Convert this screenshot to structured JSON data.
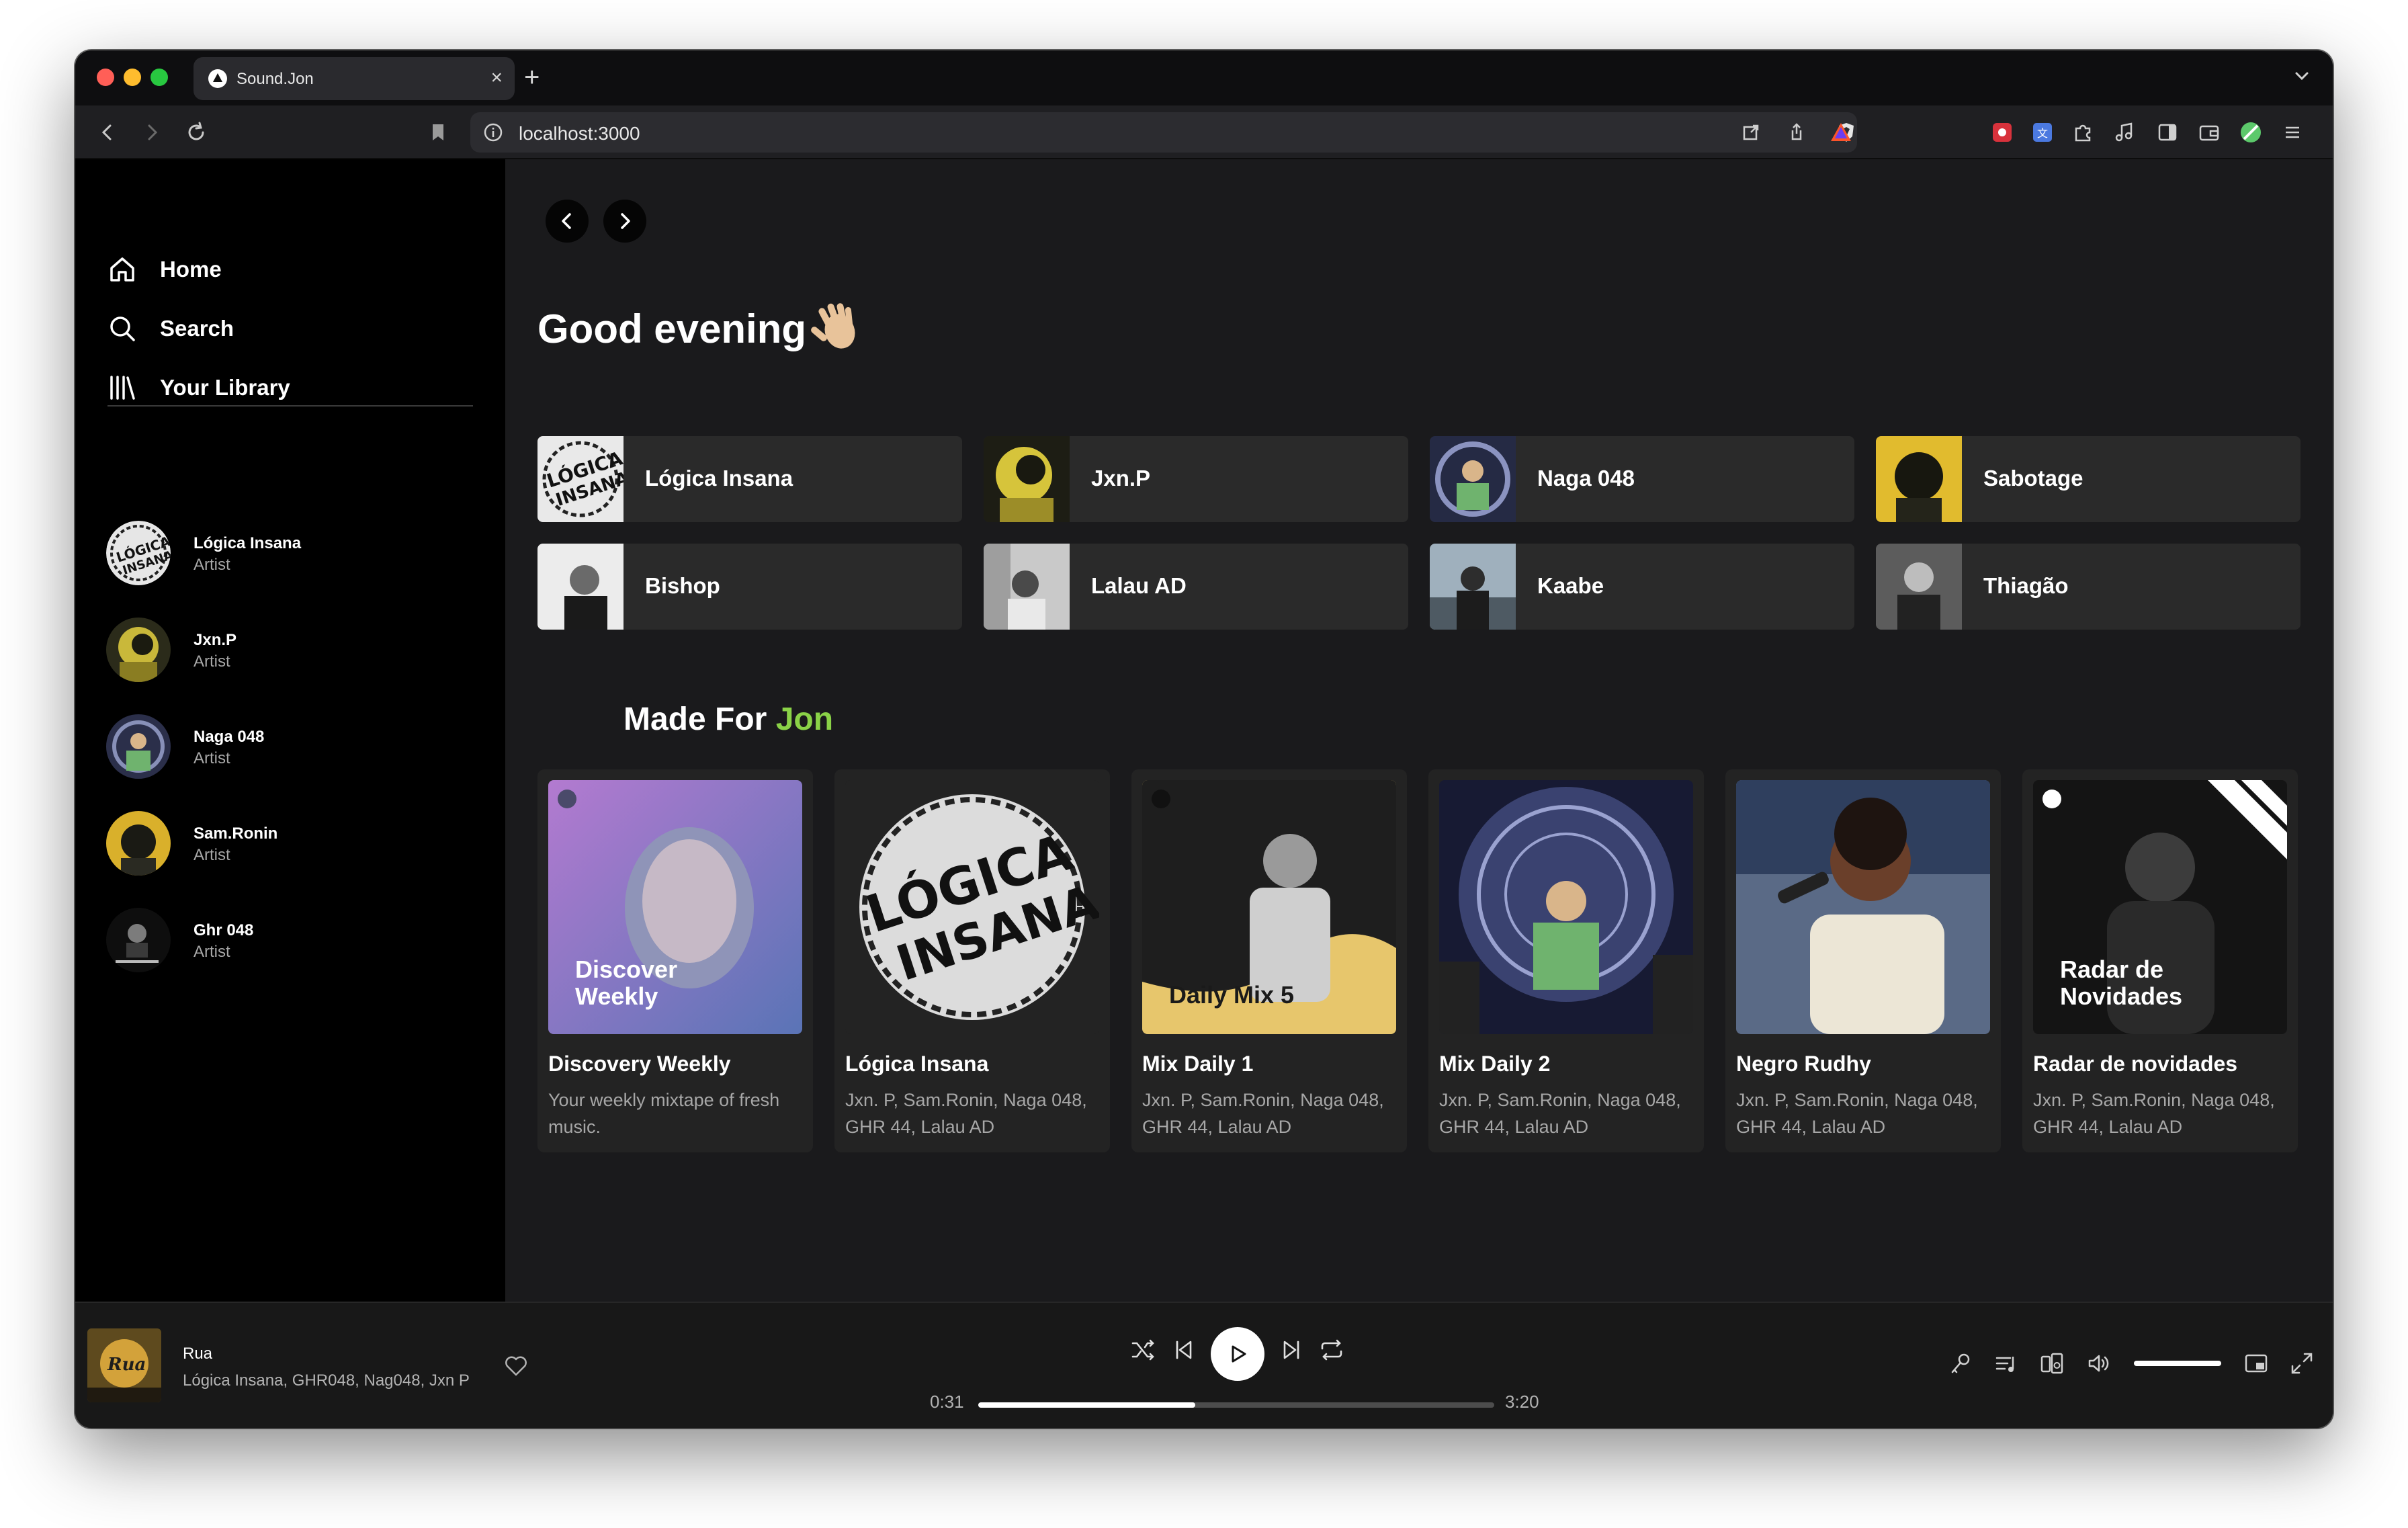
{
  "browser": {
    "tab_title": "Sound.Jon",
    "tab_close": "×",
    "new_tab": "+",
    "url": "localhost:3000"
  },
  "sidebar": {
    "nav": [
      {
        "label": "Home",
        "icon": "home-icon"
      },
      {
        "label": "Search",
        "icon": "search-icon"
      },
      {
        "label": "Your Library",
        "icon": "library-icon"
      }
    ],
    "artists": [
      {
        "name": "Lógica Insana",
        "type": "Artist"
      },
      {
        "name": "Jxn.P",
        "type": "Artist"
      },
      {
        "name": "Naga 048",
        "type": "Artist"
      },
      {
        "name": "Sam.Ronin",
        "type": "Artist"
      },
      {
        "name": "Ghr 048",
        "type": "Artist"
      }
    ]
  },
  "main": {
    "greeting": "Good evening",
    "greeting_emoji": "👋",
    "quick_picks": [
      {
        "label": "Lógica Insana"
      },
      {
        "label": "Jxn.P"
      },
      {
        "label": "Naga 048"
      },
      {
        "label": "Sabotage"
      },
      {
        "label": "Bishop"
      },
      {
        "label": "Lalau AD"
      },
      {
        "label": "Kaabe"
      },
      {
        "label": "Thiagão"
      }
    ],
    "made_for_prefix": "Made For ",
    "made_for_user": "Jon",
    "cards": [
      {
        "title": "Discovery Weekly",
        "desc": "Your weekly mixtape of fresh music.",
        "art_text": "Discover Weekly"
      },
      {
        "title": "Lógica Insana",
        "desc": "Jxn. P, Sam.Ronin, Naga 048, GHR 44, Lalau AD",
        "art_text": ""
      },
      {
        "title": "Mix Daily 1",
        "desc": "Jxn. P, Sam.Ronin, Naga 048, GHR 44, Lalau AD",
        "art_text": "Daily Mix 5"
      },
      {
        "title": "Mix Daily 2",
        "desc": "Jxn. P, Sam.Ronin, Naga 048, GHR 44, Lalau AD",
        "art_text": ""
      },
      {
        "title": "Negro Rudhy",
        "desc": "Jxn. P, Sam.Ronin, Naga 048, GHR 44, Lalau AD",
        "art_text": ""
      },
      {
        "title": "Radar de novidades",
        "desc": "Jxn. P, Sam.Ronin, Naga 048, GHR 44, Lalau AD",
        "art_text": "Radar de Novidades"
      }
    ]
  },
  "player": {
    "title": "Rua",
    "artists": "Lógica Insana, GHR048, Nag048, Jxn P",
    "elapsed": "0:31",
    "duration": "3:20",
    "progress_fraction": 0.42,
    "volume_fraction": 1.0
  },
  "colors": {
    "accent_green": "#8ad247",
    "background": "#121212",
    "sidebar": "#000000",
    "card": "#232323"
  }
}
